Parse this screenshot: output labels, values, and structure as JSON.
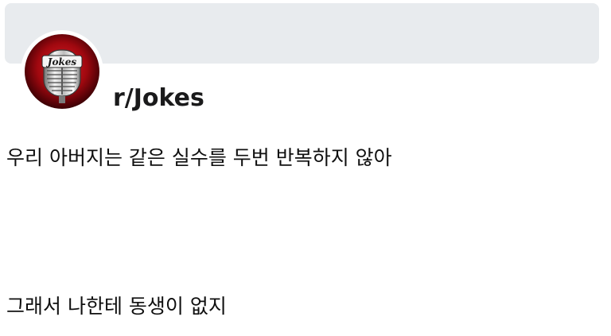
{
  "header": {
    "subreddit": "r/Jokes",
    "avatar_icon": "microphone-icon",
    "avatar_logo_text": "Jokes",
    "banner_color": "#e8ebee",
    "avatar_accent": "#c0101a"
  },
  "post": {
    "title": "우리 아버지는 같은 실수를 두번 반복하지 않아",
    "body": "그래서 나한테 동생이 없지"
  }
}
